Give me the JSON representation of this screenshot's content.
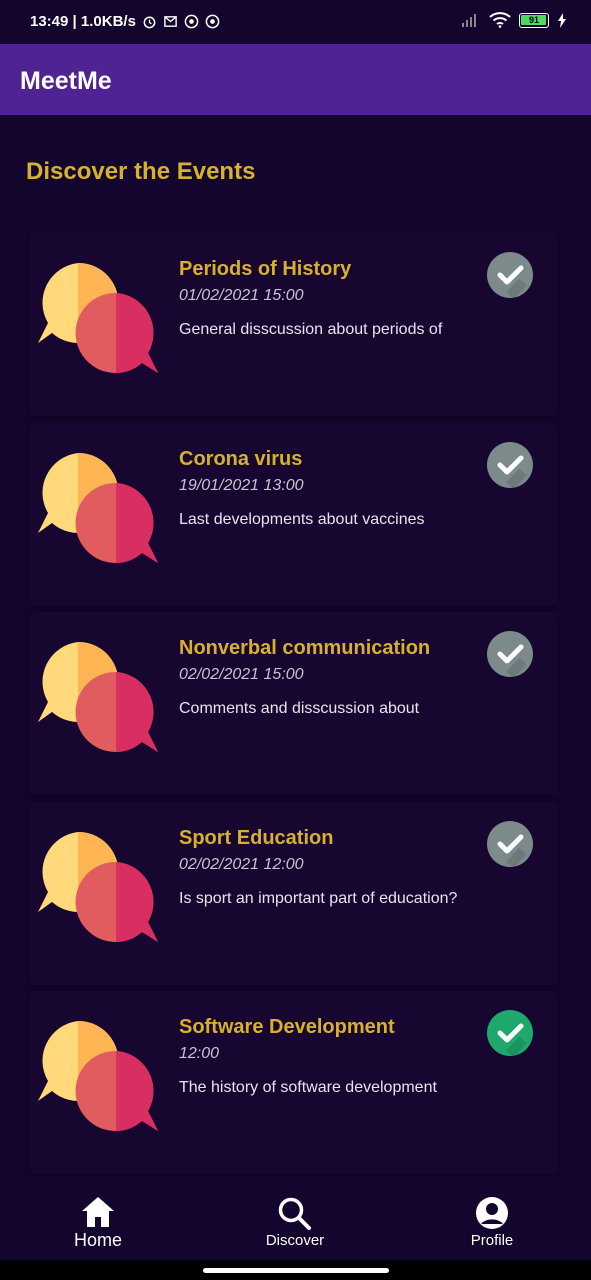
{
  "status_bar": {
    "time_speed": "13:49 | 1.0KB/s",
    "battery": "91"
  },
  "app_bar": {
    "title": "MeetMe"
  },
  "section_title": "Discover the Events",
  "events": [
    {
      "title": "Periods of History",
      "datetime": "01/02/2021  15:00",
      "description": "General disscussion about periods of",
      "joined": false
    },
    {
      "title": "Corona virus",
      "datetime": "19/01/2021  13:00",
      "description": "Last developments about vaccines",
      "joined": false
    },
    {
      "title": "Nonverbal communication",
      "datetime": "02/02/2021  15:00",
      "description": "Comments and disscussion about",
      "joined": false
    },
    {
      "title": "Sport Education",
      "datetime": "02/02/2021  12:00",
      "description": "Is sport an important part of education?",
      "joined": false
    },
    {
      "title": "Software Development",
      "datetime": "12:00",
      "description": "The history of software development",
      "joined": true
    }
  ],
  "bottom_nav": {
    "items": [
      {
        "label": "Home",
        "icon": "home-icon",
        "active": true
      },
      {
        "label": "Discover",
        "icon": "search-icon",
        "active": false
      },
      {
        "label": "Profile",
        "icon": "profile-icon",
        "active": false
      }
    ]
  },
  "colors": {
    "background": "#14052e",
    "app_bar": "#4f2391",
    "accent_title": "#d6b12e",
    "check_inactive": "#7d8a8b",
    "check_active": "#1fa86b"
  }
}
